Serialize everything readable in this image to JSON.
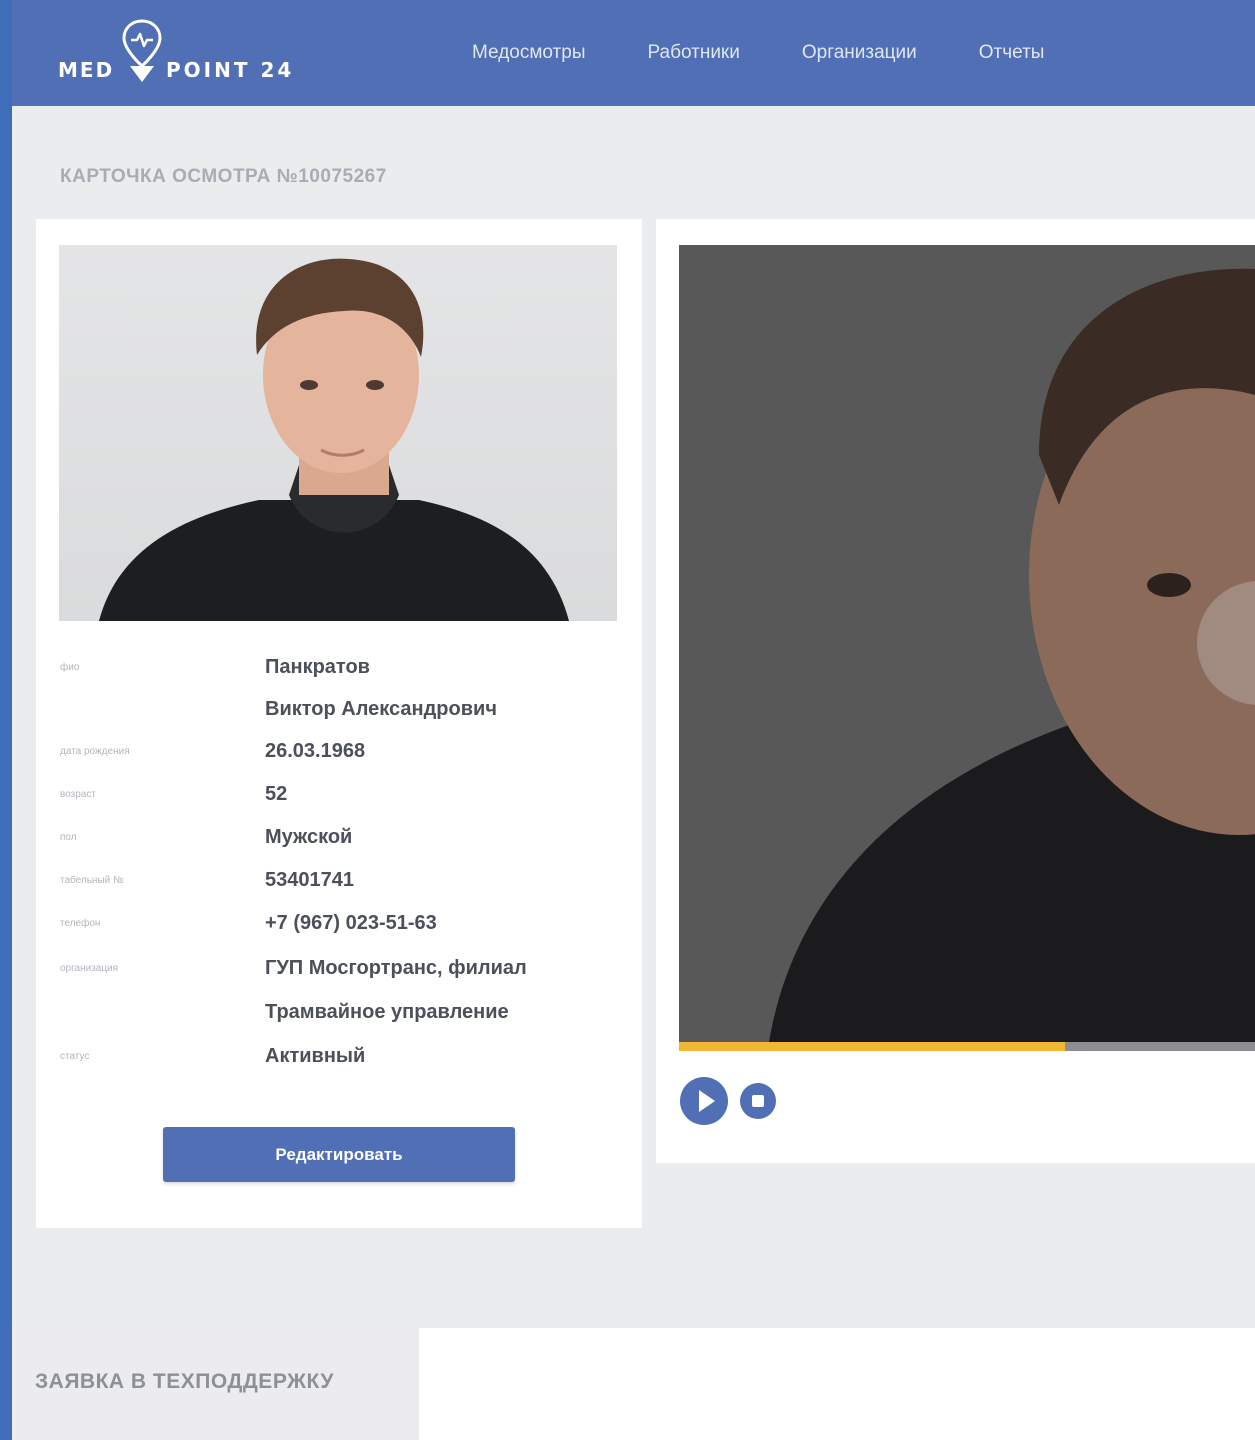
{
  "header": {
    "logo_left": "MED",
    "logo_right": "POINT 24",
    "nav": [
      {
        "label": "Медосмотры"
      },
      {
        "label": "Работники"
      },
      {
        "label": "Организации"
      },
      {
        "label": "Отчеты"
      }
    ]
  },
  "page": {
    "title": "КАРТОЧКА ОСМОТРА №10075267"
  },
  "employee": {
    "fields": [
      {
        "label": "ФИО",
        "value": "Панкратов",
        "value_cont": "Виктор Александрович"
      },
      {
        "label": "Дата рождения",
        "value": "26.03.1968"
      },
      {
        "label": "Возраст",
        "value": "52"
      },
      {
        "label": "Пол",
        "value": "Мужской"
      },
      {
        "label": "Табельный №",
        "value": "53401741"
      },
      {
        "label": "Телефон",
        "value": "+7 (967) 023-51-63"
      },
      {
        "label": "Организация",
        "value": "ГУП Мосгортранс, филиал",
        "value_cont": "Трамвайное управление"
      },
      {
        "label": "Статус",
        "value": "Активный"
      }
    ],
    "edit_label": "Редактировать"
  },
  "video": {
    "progress": 0.67,
    "accent": "#f2b635"
  },
  "footer": {
    "support_label": "ЗАЯВКА В ТЕХПОДДЕРЖКУ"
  },
  "colors": {
    "brand": "#506fb4",
    "background": "#ebecee"
  }
}
